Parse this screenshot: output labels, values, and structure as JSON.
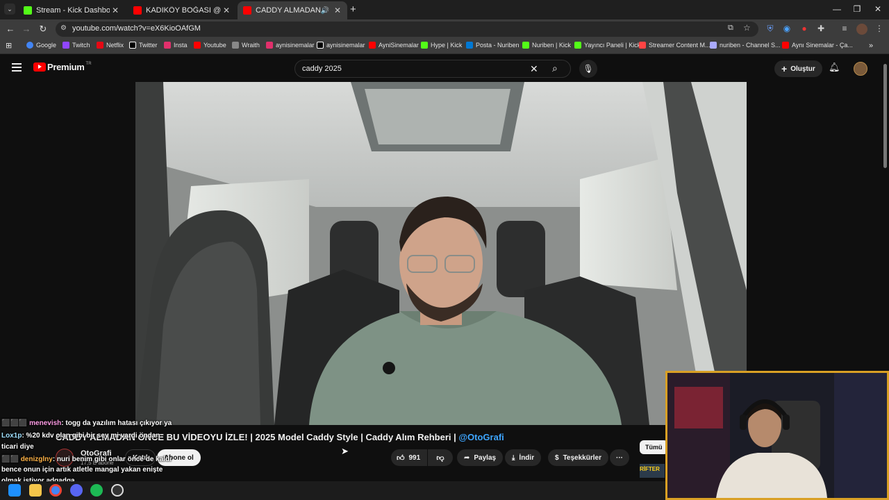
{
  "browser": {
    "tabs": [
      {
        "title": "Stream - Kick Dashboard",
        "favicon_color": "#53fc18",
        "active": false
      },
      {
        "title": "KADIKÖY BOĞASI @Asitmen İLE...",
        "favicon_color": "#ff0000",
        "active": false
      },
      {
        "title": "CADDY ALMADAN ÖNCE B",
        "favicon_color": "#ff0000",
        "active": true
      }
    ],
    "url": "youtube.com/watch?v=eX6KioOAfGM",
    "bookmarks": [
      {
        "label": "Google",
        "color": "#4285f4"
      },
      {
        "label": "Twitch",
        "color": "#9146ff"
      },
      {
        "label": "Netflix",
        "color": "#e50914"
      },
      {
        "label": "Twitter",
        "color": "#ffffff"
      },
      {
        "label": "Insta",
        "color": "#e1306c"
      },
      {
        "label": "Youtube",
        "color": "#ff0000"
      },
      {
        "label": "Wraith",
        "color": "#cccccc"
      },
      {
        "label": "aynisinemalar",
        "color": "#e1306c"
      },
      {
        "label": "aynisinemalar",
        "color": "#ffffff"
      },
      {
        "label": "AyniSinemalar",
        "color": "#ff0000"
      },
      {
        "label": "Hype | Kick",
        "color": "#53fc18"
      },
      {
        "label": "Posta - Nuriben",
        "color": "#0078d4"
      },
      {
        "label": "Nuriben | Kick",
        "color": "#53fc18"
      },
      {
        "label": "Yayıncı Paneli | Kick",
        "color": "#53fc18"
      },
      {
        "label": "Streamer Content M...",
        "color": "#ff4444"
      },
      {
        "label": "nuriben - Channel S...",
        "color": "#aaaaff"
      },
      {
        "label": "Aynı Sinemalar - Ça...",
        "color": "#ff0000"
      }
    ]
  },
  "youtube": {
    "logo_text": "Premium",
    "logo_badge": "TR",
    "search_value": "caddy 2025",
    "create_label": "Oluştur",
    "video_title_main": "CADDY ALMADAN ÖNCE BU VİDEOYU İZLE! | 2025 Model Caddy Style | Caddy Alım Rehberi | ",
    "video_title_mention": "@OtoGrafi",
    "channel_name": "OtoGrafi",
    "subscribers": "17,5 B abone",
    "join_label": "Katıl",
    "subscribe_label": "Abone ol",
    "likes": "991",
    "share_label": "Paylaş",
    "download_label": "İndir",
    "thanks_label": "Teşekkürler",
    "more_label": "···",
    "filter_all": "Tümü",
    "side_thumb_text": "RİFTER"
  },
  "chat_overlay": [
    {
      "user": "menevish",
      "text": ": togg da yazılım hatası çıkıyor ya"
    },
    {
      "user": "Lox1p",
      "text": ": %20 kdv olan gibi bir sey mi vardi ondan",
      "cont": "ticari diye"
    },
    {
      "user": "denizglny",
      "text": ": nuri benim gibi onlar önce de kaldı",
      "cont": "bence onun için artık atletle mangal yakan enişte",
      "cont2": "olmak istiyor adgadga"
    }
  ],
  "colors": {
    "accent_link": "#3ea6ff",
    "yt_red": "#ff0000",
    "webcam_border": "#d9a024"
  }
}
